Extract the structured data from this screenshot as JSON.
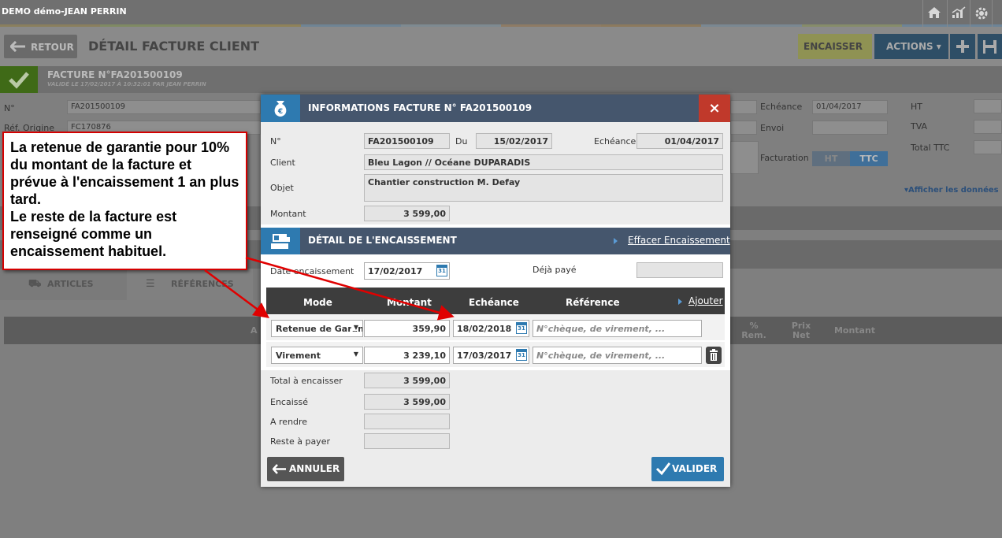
{
  "app": {
    "title": "DEMO démo-JEAN PERRIN"
  },
  "top_strip_colors": [
    "#8a7f5e",
    "#7f8a63",
    "#8f8259",
    "#6f8494",
    "#7e8a91",
    "#8e7b65",
    "#8c7a5e",
    "#7a8892",
    "#868c6a",
    "#6d8497"
  ],
  "header": {
    "back_label": "RETOUR",
    "title": "DÉTAIL FACTURE CLIENT",
    "encaisser_label": "ENCAISSER",
    "actions_label": "ACTIONS ▾"
  },
  "facture_bar": {
    "number": "FACTURE N°FA201500109",
    "valide": "VALIDÉ LE 17/02/2017 À 10:32:01 PAR JEAN PERRIN"
  },
  "bg_form": {
    "no_label": "N°",
    "no_value": "FA201500109",
    "ref_label": "Réf. Origine",
    "ref_value": "FC170876",
    "echeance_label": "Echéance",
    "echeance_value": "01/04/2017",
    "envoi_label": "Envoi",
    "ht_label": "HT",
    "tva_label": "TVA",
    "total_ttc_label": "Total TTC",
    "facturation_label": "Facturation",
    "ht_toggle": "HT",
    "ttc_toggle": "TTC",
    "afficher_link": "▾Afficher les données",
    "tab_articles": "ARTICLES",
    "tab_references": "RÉFÉRENCES",
    "col_a": "A",
    "col_rem": "%\nRem.",
    "col_prix": "Prix\nNet",
    "col_montant": "Montant"
  },
  "modal": {
    "title": "INFORMATIONS FACTURE N° FA201500109",
    "close": "×",
    "no_label": "N°",
    "no_value": "FA201500109",
    "du_label": "Du",
    "du_value": "15/02/2017",
    "echeance_label": "Echéance",
    "echeance_value": "01/04/2017",
    "client_label": "Client",
    "client_value": "Bleu Lagon // Océane DUPARADIS",
    "objet_label": "Objet",
    "objet_value": "Chantier construction M. Defay",
    "montant_label": "Montant",
    "montant_value": "3 599,00",
    "enc_title": "DÉTAIL DE L'ENCAISSEMENT",
    "effacer": "Effacer Encaissement",
    "date_enc_label": "Date encaissement",
    "date_enc_value": "17/02/2017",
    "deja_paye_label": "Déjà payé",
    "deja_paye_value": "",
    "table": {
      "headers": {
        "mode": "Mode",
        "montant": "Montant",
        "echeance": "Echéance",
        "reference": "Référence"
      },
      "ajouter": "Ajouter",
      "rows": [
        {
          "mode": "Retenue de Garantie",
          "montant": "359,90",
          "echeance": "18/02/2018",
          "reference_placeholder": "N°chèque, de virement, ..."
        },
        {
          "mode": "Virement",
          "montant": "3 239,10",
          "echeance": "17/03/2017",
          "reference_placeholder": "N°chèque, de virement, ..."
        }
      ]
    },
    "totals": {
      "total_label": "Total à encaisser",
      "total_value": "3 599,00",
      "encaisse_label": "Encaissé",
      "encaisse_value": "3 599,00",
      "rendre_label": "A rendre",
      "rendre_value": "",
      "reste_label": "Reste à payer",
      "reste_value": ""
    },
    "annuler": "ANNULER",
    "valider": "VALIDER",
    "cal_day": "31"
  },
  "annotation": {
    "lines": [
      "La retenue de garantie pour 10% du montant de la facture et prévue à l'encaissement 1 an plus tard.",
      "Le reste de la facture est renseigné comme un encaissement habituel."
    ]
  }
}
